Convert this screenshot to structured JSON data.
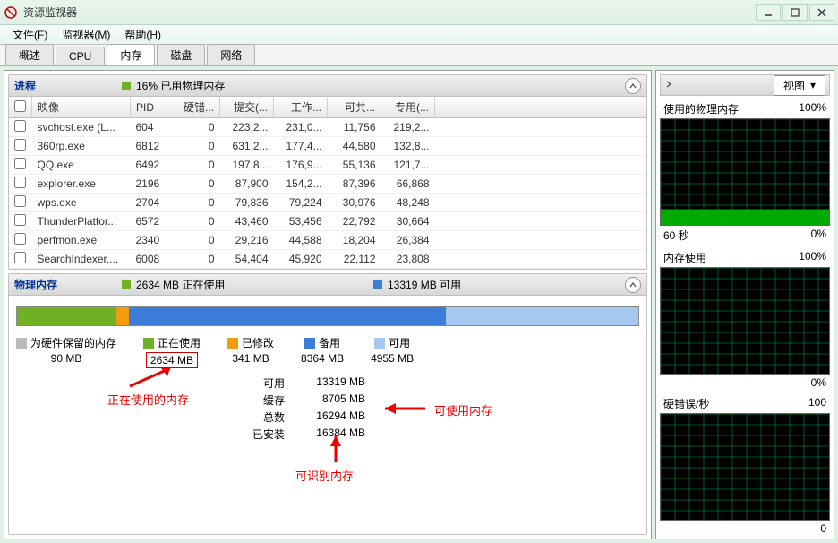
{
  "window": {
    "title": "资源监视器"
  },
  "menu": [
    "文件(F)",
    "监视器(M)",
    "帮助(H)"
  ],
  "tabs": [
    {
      "label": "概述"
    },
    {
      "label": "CPU"
    },
    {
      "label": "内存",
      "active": true
    },
    {
      "label": "磁盘"
    },
    {
      "label": "网络"
    }
  ],
  "proc": {
    "title": "进程",
    "usage": "16% 已用物理内存",
    "columns": [
      "映像",
      "PID",
      "硬错...",
      "提交(...",
      "工作...",
      "可共...",
      "专用(..."
    ],
    "rows": [
      [
        "svchost.exe (L...",
        "604",
        "0",
        "223,2...",
        "231,0...",
        "11,756",
        "219,2..."
      ],
      [
        "360rp.exe",
        "6812",
        "0",
        "631,2...",
        "177,4...",
        "44,580",
        "132,8..."
      ],
      [
        "QQ.exe",
        "6492",
        "0",
        "197,8...",
        "176,9...",
        "55,136",
        "121,7..."
      ],
      [
        "explorer.exe",
        "2196",
        "0",
        "87,900",
        "154,2...",
        "87,396",
        "66,868"
      ],
      [
        "wps.exe",
        "2704",
        "0",
        "79,836",
        "79,224",
        "30,976",
        "48,248"
      ],
      [
        "ThunderPlatfor...",
        "6572",
        "0",
        "43,460",
        "53,456",
        "22,792",
        "30,664"
      ],
      [
        "perfmon.exe",
        "2340",
        "0",
        "29,216",
        "44,588",
        "18,204",
        "26,384"
      ],
      [
        "SearchIndexer....",
        "6008",
        "0",
        "54,404",
        "45,920",
        "22,112",
        "23,808"
      ]
    ]
  },
  "phys": {
    "title": "物理内存",
    "inuse": "2634 MB 正在使用",
    "avail": "13319 MB 可用",
    "legend": [
      {
        "label": "为硬件保留的内存",
        "value": "90 MB",
        "color": "#bbb"
      },
      {
        "label": "正在使用",
        "value": "2634 MB",
        "color": "#6fb024",
        "hl": true
      },
      {
        "label": "已修改",
        "value": "341 MB",
        "color": "#f39c12"
      },
      {
        "label": "备用",
        "value": "8364 MB",
        "color": "#3b7dd8"
      },
      {
        "label": "可用",
        "value": "4955 MB",
        "color": "#a4c8f0"
      }
    ],
    "details": [
      {
        "lbl": "可用",
        "val": "13319 MB"
      },
      {
        "lbl": "缓存",
        "val": "8705 MB"
      },
      {
        "lbl": "总数",
        "val": "16294 MB"
      },
      {
        "lbl": "已安装",
        "val": "16384 MB"
      }
    ],
    "annot": {
      "inuse": "正在使用的内存",
      "usable": "可使用内存",
      "recog": "可识别内存"
    }
  },
  "right": {
    "view": "视图",
    "g1": {
      "title": "使用的物理内存",
      "max": "100%",
      "btm_l": "60 秒",
      "btm_r": "0%"
    },
    "g2": {
      "title": "内存使用",
      "max": "100%",
      "btm_r": "0%"
    },
    "g3": {
      "title": "硬错误/秒",
      "max": "100",
      "btm_r": "0"
    }
  }
}
